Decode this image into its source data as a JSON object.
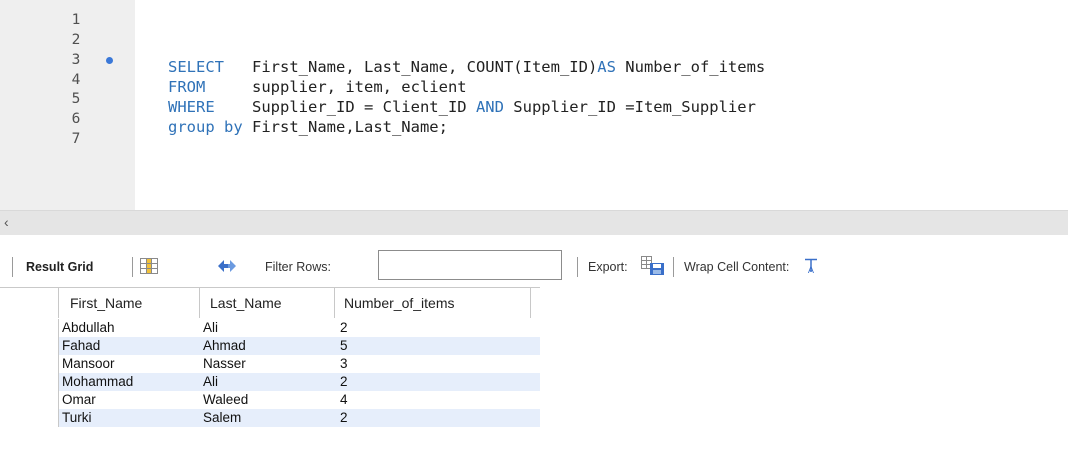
{
  "editor": {
    "line_numbers": [
      "1",
      "2",
      "3",
      "4",
      "5",
      "6",
      "7"
    ],
    "lines": [
      {
        "kw": "SELECT",
        "pad": "   ",
        "kw2": "",
        "rest": "First_Name, Last_Name, COUNT(Item_ID)",
        "kw3": "AS",
        "rest2": " Number_of_items"
      },
      {
        "kw": "FROM",
        "pad": "     ",
        "rest": "supplier, item, eclient"
      },
      {
        "kw": "WHERE",
        "pad": "    ",
        "rest": "Supplier_ID = Client_ID ",
        "kw3": "AND",
        "rest2": " Supplier_ID =Item_Supplier"
      },
      {
        "kw": "group by",
        "pad": " ",
        "rest": "First_Name,Last_Name;"
      }
    ]
  },
  "toolbar": {
    "result_grid_label": "Result Grid",
    "filter_rows_label": "Filter Rows:",
    "filter_value": "",
    "export_label": "Export:",
    "wrap_label": "Wrap Cell Content:"
  },
  "grid": {
    "columns": [
      "First_Name",
      "Last_Name",
      "Number_of_items"
    ],
    "rows": [
      [
        "Abdullah",
        "Ali",
        "2"
      ],
      [
        "Fahad",
        "Ahmad",
        "5"
      ],
      [
        "Mansoor",
        "Nasser",
        "3"
      ],
      [
        "Mohammad",
        "Ali",
        "2"
      ],
      [
        "Omar",
        "Waleed",
        "4"
      ],
      [
        "Turki",
        "Salem",
        "2"
      ]
    ]
  },
  "colors": {
    "keyword": "#2f72b8",
    "breakpoint": "#3a78d8",
    "alt_row": "#e6eefb"
  }
}
